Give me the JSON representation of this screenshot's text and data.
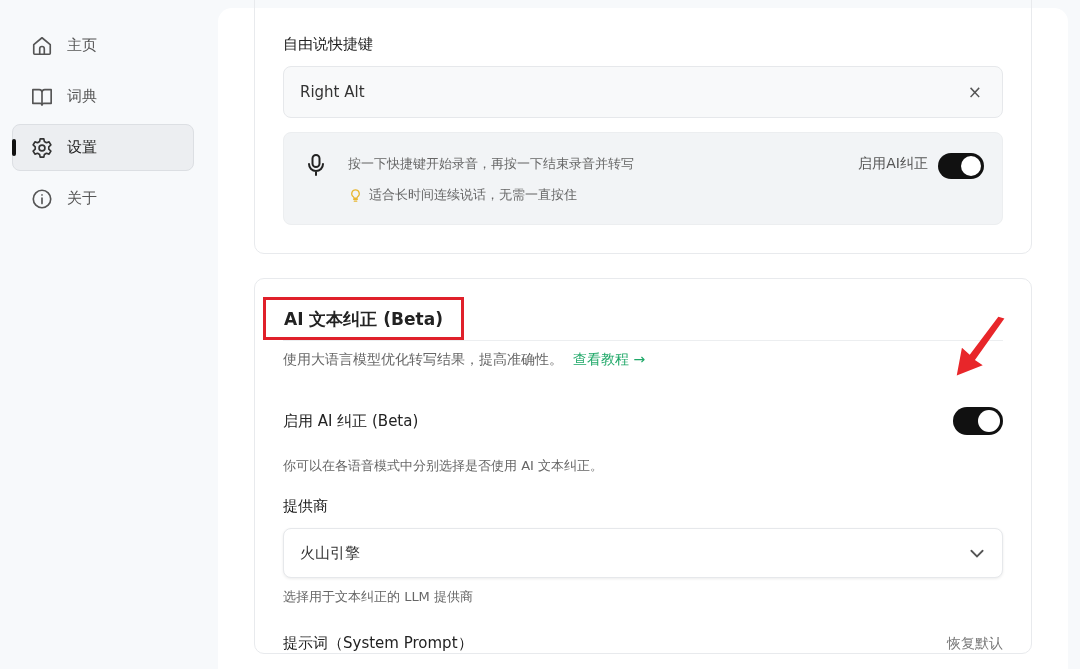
{
  "sidebar": {
    "items": [
      {
        "label": "主页",
        "kind": "home",
        "selected": false
      },
      {
        "label": "词典",
        "kind": "book",
        "selected": false
      },
      {
        "label": "设置",
        "kind": "gear",
        "selected": true
      },
      {
        "label": "关于",
        "kind": "info",
        "selected": false
      }
    ]
  },
  "hotkey_card": {
    "label": "自由说快捷键",
    "field": {
      "value": "Right Alt",
      "clear": "×"
    },
    "info": {
      "text": "按一下快捷键开始录音，再按一下结束录音并转写",
      "tip": "适合长时间连续说话，无需一直按住",
      "toggle_label": "启用AI纠正",
      "toggle_on": true
    }
  },
  "ai_card": {
    "title": "AI 文本纠正 (Beta)",
    "highlighted": true,
    "description": "使用大语言模型优化转写结果，提高准确性。",
    "link": "查看教程 →",
    "enable": {
      "label": "启用 AI 纠正 (Beta)",
      "on": true,
      "pointed": true
    },
    "enable_hint": "你可以在各语音模式中分别选择是否使用 AI 文本纠正。",
    "provider": {
      "label": "提供商",
      "value": "火山引擎",
      "hint": "选择用于文本纠正的 LLM 提供商"
    },
    "prompt": {
      "label": "提示词（System Prompt）",
      "reset": "恢复默认"
    }
  }
}
